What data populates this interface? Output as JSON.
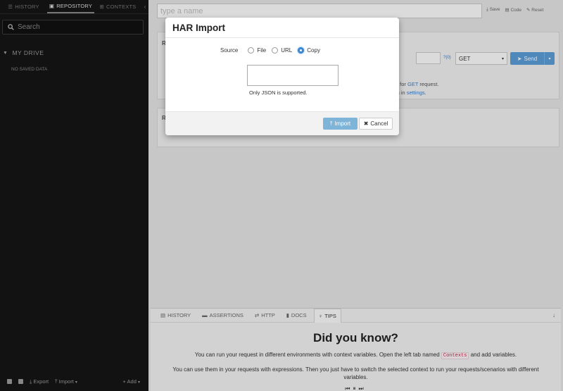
{
  "sidebar": {
    "tabs": [
      {
        "icon": "list-icon",
        "label": "HISTORY"
      },
      {
        "icon": "save-icon",
        "label": "REPOSITORY"
      },
      {
        "icon": "grid-icon",
        "label": "CONTEXTS"
      }
    ],
    "active_tab": "REPOSITORY",
    "search_placeholder": "Search",
    "drive_label": "MY DRIVE",
    "empty_text": "NO SAVED DATA",
    "bottom": {
      "export_label": "Export",
      "import_label": "Import",
      "add_label": "Add"
    }
  },
  "main": {
    "name_placeholder": "type a name",
    "actions": {
      "save_label": "Save",
      "code_label": "Code",
      "reset_label": "Reset"
    },
    "panel1": {
      "letter": "R",
      "q_label": "?(0)",
      "method": "GET",
      "send_label": "Send",
      "line1_pre": "ads for ",
      "line1_link": "GET",
      "line1_post": " request.",
      "line2_pre": "ition in ",
      "line2_link": "settings",
      "line2_post": "."
    },
    "panel2": {
      "letter": "R"
    }
  },
  "tips": {
    "tabs": [
      {
        "icon": "history-icon",
        "label": "HISTORY"
      },
      {
        "icon": "assertions-icon",
        "label": "ASSERTIONS"
      },
      {
        "icon": "http-icon",
        "label": "HTTP"
      },
      {
        "icon": "docs-icon",
        "label": "DOCS"
      },
      {
        "icon": "tips-icon",
        "label": "TIPS"
      }
    ],
    "active_tab": "TIPS",
    "title": "Did you know?",
    "line1_pre": "You can run your request in different environments with context variables. Open the left tab named ",
    "line1_code": "Contexts",
    "line1_post": " and add variables.",
    "line2": "You can use them in your requests with expressions. Then you just have to switch the selected context to run your requests/scenarios with different variables."
  },
  "modal": {
    "title": "HAR Import",
    "source_label": "Source",
    "options": [
      "File",
      "URL",
      "Copy"
    ],
    "selected_option": "Copy",
    "textarea_value": "",
    "help_text": "Only JSON is supported.",
    "import_label": "Import",
    "cancel_label": "Cancel"
  },
  "colors": {
    "sidebar_bg": "#151515",
    "accent": "#5b9bd5",
    "import_btn": "#7fb4d9"
  }
}
